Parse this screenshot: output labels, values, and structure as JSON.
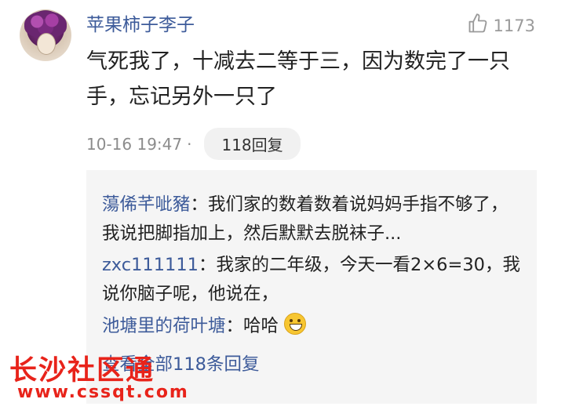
{
  "comment": {
    "username": "苹果柿子李子",
    "likes": "1173",
    "text": "气死我了，十减去二等于三，因为数完了一只手，忘记另外一只了",
    "timestamp": "10-16 19:47",
    "separator": "·",
    "reply_count_label": "118回复"
  },
  "replies": [
    {
      "name": "蕩俙芊呲豬",
      "sep": "：",
      "text": "我们家的数着数着说妈妈手指不够了，我说把脚指加上，然后默默去脱袜子..."
    },
    {
      "name": "zxc111111",
      "sep": "：",
      "text": "我家的二年级，今天一看2×6=30，我说你脑子呢，他说在，"
    },
    {
      "name": "池塘里的荷叶塘",
      "sep": "：",
      "text": "哈哈"
    }
  ],
  "view_all_label": "查看全部118条回复",
  "watermark": {
    "title": "长沙社区通",
    "url": "www.cssqt.com"
  },
  "colors": {
    "name_blue": "#3d5b9a",
    "watermark_red": "#e8231a"
  },
  "icons": {
    "like": "thumbs-up-icon",
    "emoji": "grinning-face-icon"
  }
}
